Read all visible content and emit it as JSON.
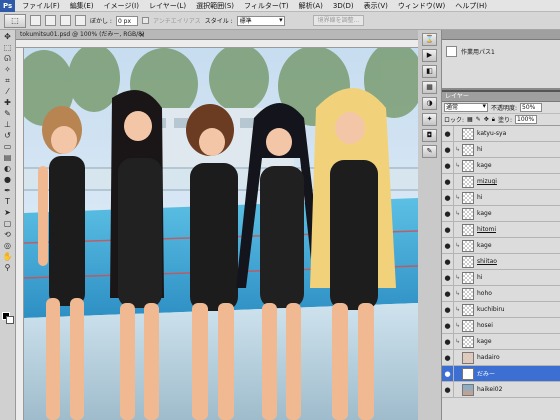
{
  "menubar": {
    "app_label": "Ps",
    "items": [
      "ファイル(F)",
      "編集(E)",
      "イメージ(I)",
      "レイヤー(L)",
      "選択範囲(S)",
      "フィルター(T)",
      "解析(A)",
      "3D(D)",
      "表示(V)",
      "ウィンドウ(W)",
      "ヘルプ(H)"
    ],
    "zoom": "100%"
  },
  "options": {
    "feather_label": "ぼかし :",
    "feather_value": "0 px",
    "antialias_label": "アンチエイリアス",
    "style_label": "スタイル :",
    "style_value": "標準",
    "refine_edge_label": "境界線を調整..."
  },
  "document": {
    "title": "tokumitsu01.psd @ 100% (だみー, RGB/8)",
    "close": "×"
  },
  "history": {
    "item": "作業用パス1"
  },
  "layers": {
    "tab_label": "レイヤー",
    "blend_mode": "通常",
    "opacity_label": "不透明度:",
    "opacity_value": "50%",
    "lock_label": "ロック:",
    "fill_label": "塗り:",
    "fill_value": "100%",
    "items": [
      {
        "name": "katyu-sya",
        "thumb": "checker",
        "linked": false,
        "selected": false,
        "underline": false
      },
      {
        "name": "hi",
        "thumb": "checker",
        "linked": true,
        "selected": false,
        "underline": false
      },
      {
        "name": "kage",
        "thumb": "checker",
        "linked": true,
        "selected": false,
        "underline": false
      },
      {
        "name": "mizugi",
        "thumb": "checker",
        "linked": false,
        "selected": false,
        "underline": true
      },
      {
        "name": "hi",
        "thumb": "checker",
        "linked": true,
        "selected": false,
        "underline": false
      },
      {
        "name": "kage",
        "thumb": "checker",
        "linked": true,
        "selected": false,
        "underline": false
      },
      {
        "name": "hitomi",
        "thumb": "checker",
        "linked": false,
        "selected": false,
        "underline": true
      },
      {
        "name": "kage",
        "thumb": "checker",
        "linked": true,
        "selected": false,
        "underline": false
      },
      {
        "name": "shiitao",
        "thumb": "checker",
        "linked": false,
        "selected": false,
        "underline": true
      },
      {
        "name": "hi",
        "thumb": "checker",
        "linked": true,
        "selected": false,
        "underline": false
      },
      {
        "name": "hoho",
        "thumb": "checker",
        "linked": true,
        "selected": false,
        "underline": false
      },
      {
        "name": "kuchibiru",
        "thumb": "checker",
        "linked": true,
        "selected": false,
        "underline": false
      },
      {
        "name": "hosei",
        "thumb": "checker",
        "linked": true,
        "selected": false,
        "underline": false
      },
      {
        "name": "kage",
        "thumb": "checker",
        "linked": true,
        "selected": false,
        "underline": false
      },
      {
        "name": "hadairo",
        "thumb": "tinted",
        "linked": false,
        "selected": false,
        "underline": false
      },
      {
        "name": "だみー",
        "thumb": "white",
        "linked": false,
        "selected": true,
        "underline": false
      },
      {
        "name": "haikei02",
        "thumb": "photo",
        "linked": false,
        "selected": false,
        "underline": false
      }
    ]
  }
}
